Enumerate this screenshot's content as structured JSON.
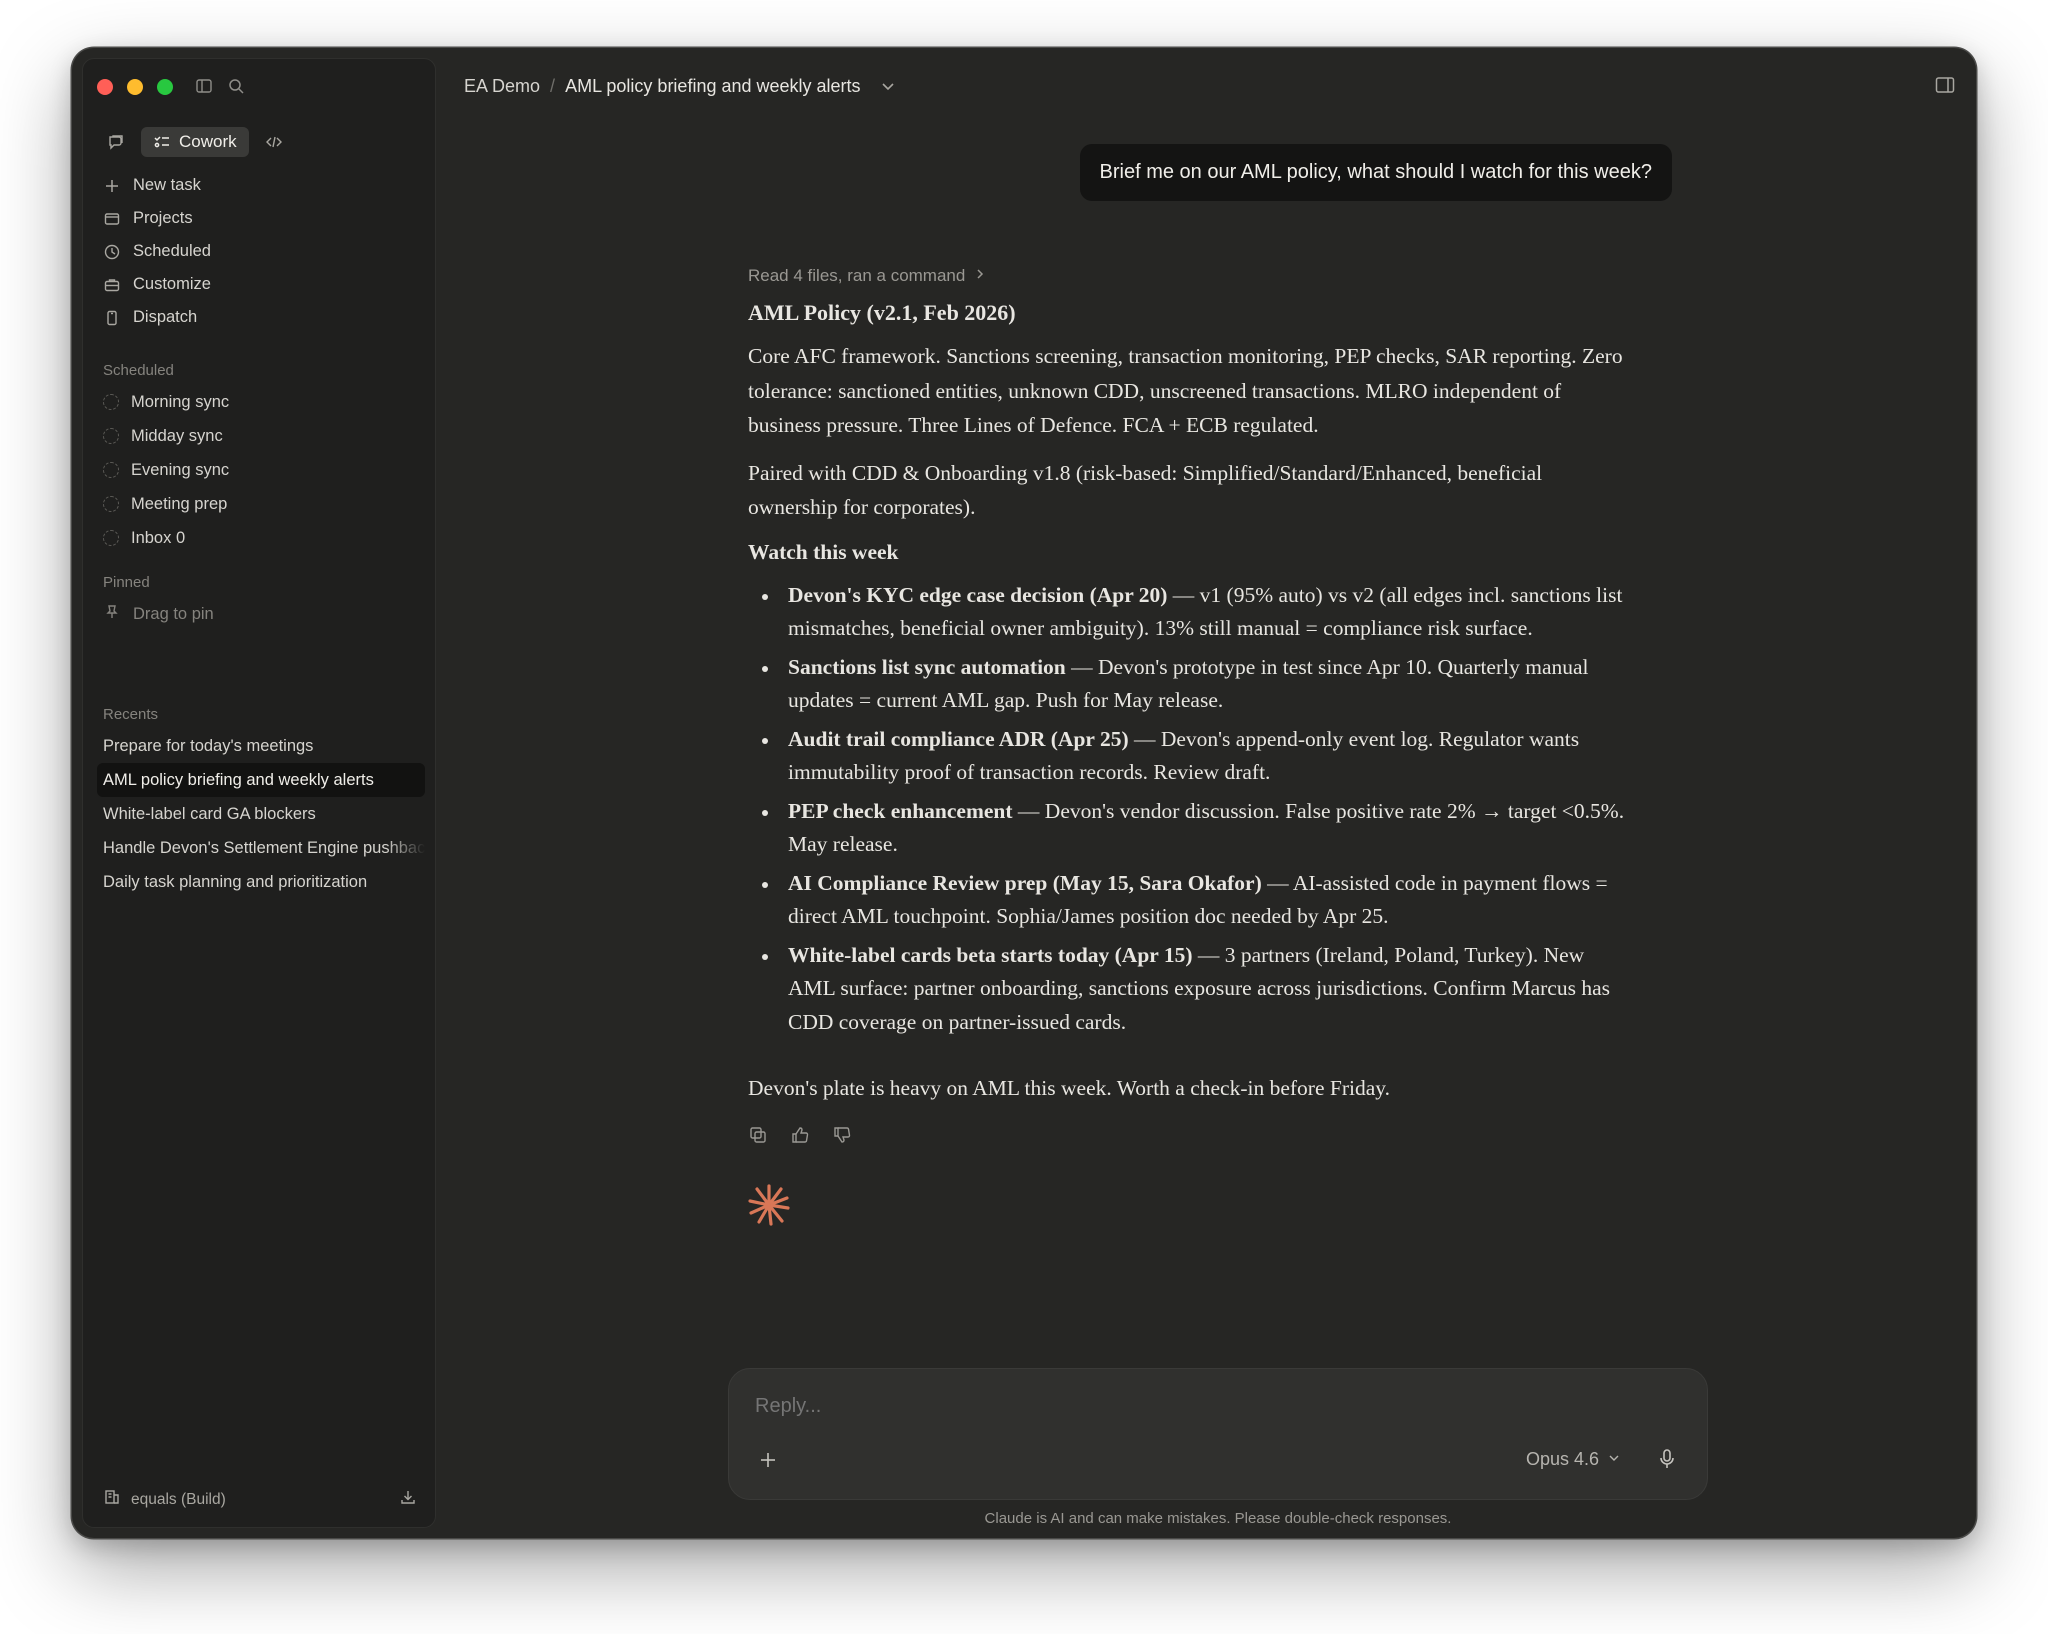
{
  "window": {
    "traffic_lights": [
      "close",
      "minimize",
      "zoom"
    ]
  },
  "sidebar": {
    "mode_active_label": "Cowork",
    "nav": [
      {
        "label": "New task",
        "icon": "plus-icon"
      },
      {
        "label": "Projects",
        "icon": "folder-icon"
      },
      {
        "label": "Scheduled",
        "icon": "clock-icon"
      },
      {
        "label": "Customize",
        "icon": "briefcase-icon"
      },
      {
        "label": "Dispatch",
        "icon": "phone-icon"
      }
    ],
    "scheduled_label": "Scheduled",
    "scheduled": [
      "Morning sync",
      "Midday sync",
      "Evening sync",
      "Meeting prep",
      "Inbox 0"
    ],
    "pinned_label": "Pinned",
    "pinned_placeholder": "Drag to pin",
    "recents_label": "Recents",
    "recents": [
      "Prepare for today's meetings",
      "AML policy briefing and weekly alerts",
      "White-label card GA blockers",
      "Handle Devon's Settlement Engine pushback",
      "Daily task planning and prioritization"
    ],
    "footer_workspace": "equals (Build)"
  },
  "header": {
    "root": "EA Demo",
    "separator": "/",
    "title": "AML policy briefing and weekly alerts"
  },
  "chat": {
    "user_message": "Brief me on our AML policy, what should I watch for this week?",
    "tool_summary": "Read 4 files, ran a command",
    "heading": "AML Policy (v2.1, Feb 2026)",
    "para1": "Core AFC framework. Sanctions screening, transaction monitoring, PEP checks, SAR reporting. Zero tolerance: sanctioned entities, unknown CDD, unscreened transactions. MLRO independent of business pressure. Three Lines of Defence. FCA + ECB regulated.",
    "para2": "Paired with CDD & Onboarding v1.8 (risk-based: Simplified/Standard/Enhanced, beneficial ownership for corporates).",
    "watch_heading": "Watch this week",
    "bullets": [
      {
        "bold": "Devon's KYC edge case decision (Apr 20)",
        "text": " — v1 (95% auto) vs v2 (all edges incl. sanctions list mismatches, beneficial owner ambiguity). 13% still manual = compliance risk surface."
      },
      {
        "bold": "Sanctions list sync automation",
        "text": " — Devon's prototype in test since Apr 10. Quarterly manual updates = current AML gap. Push for May release."
      },
      {
        "bold": "Audit trail compliance ADR (Apr 25)",
        "text": " — Devon's append-only event log. Regulator wants immutability proof of transaction records. Review draft."
      },
      {
        "bold": "PEP check enhancement",
        "text": " — Devon's vendor discussion. False positive rate 2% → target <0.5%. May release."
      },
      {
        "bold": "AI Compliance Review prep (May 15, Sara Okafor)",
        "text": " — AI-assisted code in payment flows = direct AML touchpoint. Sophia/James position doc needed by Apr 25."
      },
      {
        "bold": "White-label cards beta starts today (Apr 15)",
        "text": " — 3 partners (Ireland, Poland, Turkey). New AML surface: partner onboarding, sanctions exposure across jurisdictions. Confirm Marcus has CDD coverage on partner-issued cards."
      }
    ],
    "closing": "Devon's plate is heavy on AML this week. Worth a check-in before Friday."
  },
  "composer": {
    "placeholder": "Reply...",
    "model": "Opus 4.6"
  },
  "disclaimer": "Claude is AI and can make mistakes. Please double-check responses.",
  "colors": {
    "window_bg": "#262624",
    "sidebar_bg": "#1f1f1e",
    "user_bubble_bg": "#141413",
    "composer_bg": "#30302e",
    "accent_spark": "#d97757"
  }
}
